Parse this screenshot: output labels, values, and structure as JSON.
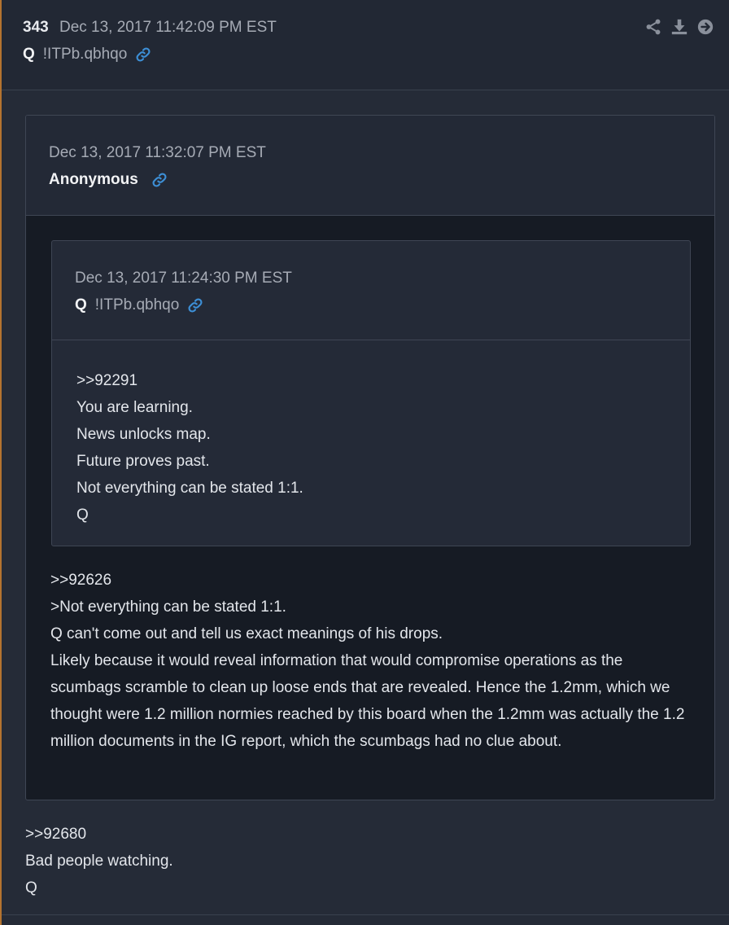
{
  "post": {
    "number": "343",
    "date": "Dec 13, 2017 11:42:09 PM EST",
    "author": "Q",
    "tripcode": "!ITPb.qbhqo",
    "icons": [
      "link-icon",
      "share-icon",
      "download-icon",
      "arrow-right-circle-icon"
    ],
    "body": [
      ">>92680",
      "Bad people watching.",
      "Q"
    ]
  },
  "quote": {
    "date": "Dec 13, 2017 11:32:07 PM EST",
    "author": "Anonymous",
    "body": [
      ">>92626",
      ">Not everything can be stated 1:1.",
      "Q can't come out and tell us exact meanings of his drops.",
      "Likely because it would reveal information that would compromise operations as the scumbags  scramble to clean up loose ends that are revealed. Hence the 1.2mm, which we thought were 1.2 million normies reached by this board  when the 1.2mm was actually the 1.2 million documents in the IG report, which the scumbags had no clue about."
    ],
    "nested": {
      "date": "Dec 13, 2017 11:24:30 PM EST",
      "author": "Q",
      "tripcode": "!ITPb.qbhqo",
      "body": [
        ">>92291",
        "You are learning.",
        "News unlocks map.",
        "Future proves past.",
        "Not everything can be stated 1:1.",
        "Q"
      ]
    }
  },
  "colors": {
    "background": "#252b37",
    "header_background": "#222834",
    "quote_background": "#161b24",
    "nested_background": "#242a37",
    "link_blue": "#3d8fd6",
    "muted_text": "#a6abb5",
    "accent_orange": "#b4732f"
  }
}
